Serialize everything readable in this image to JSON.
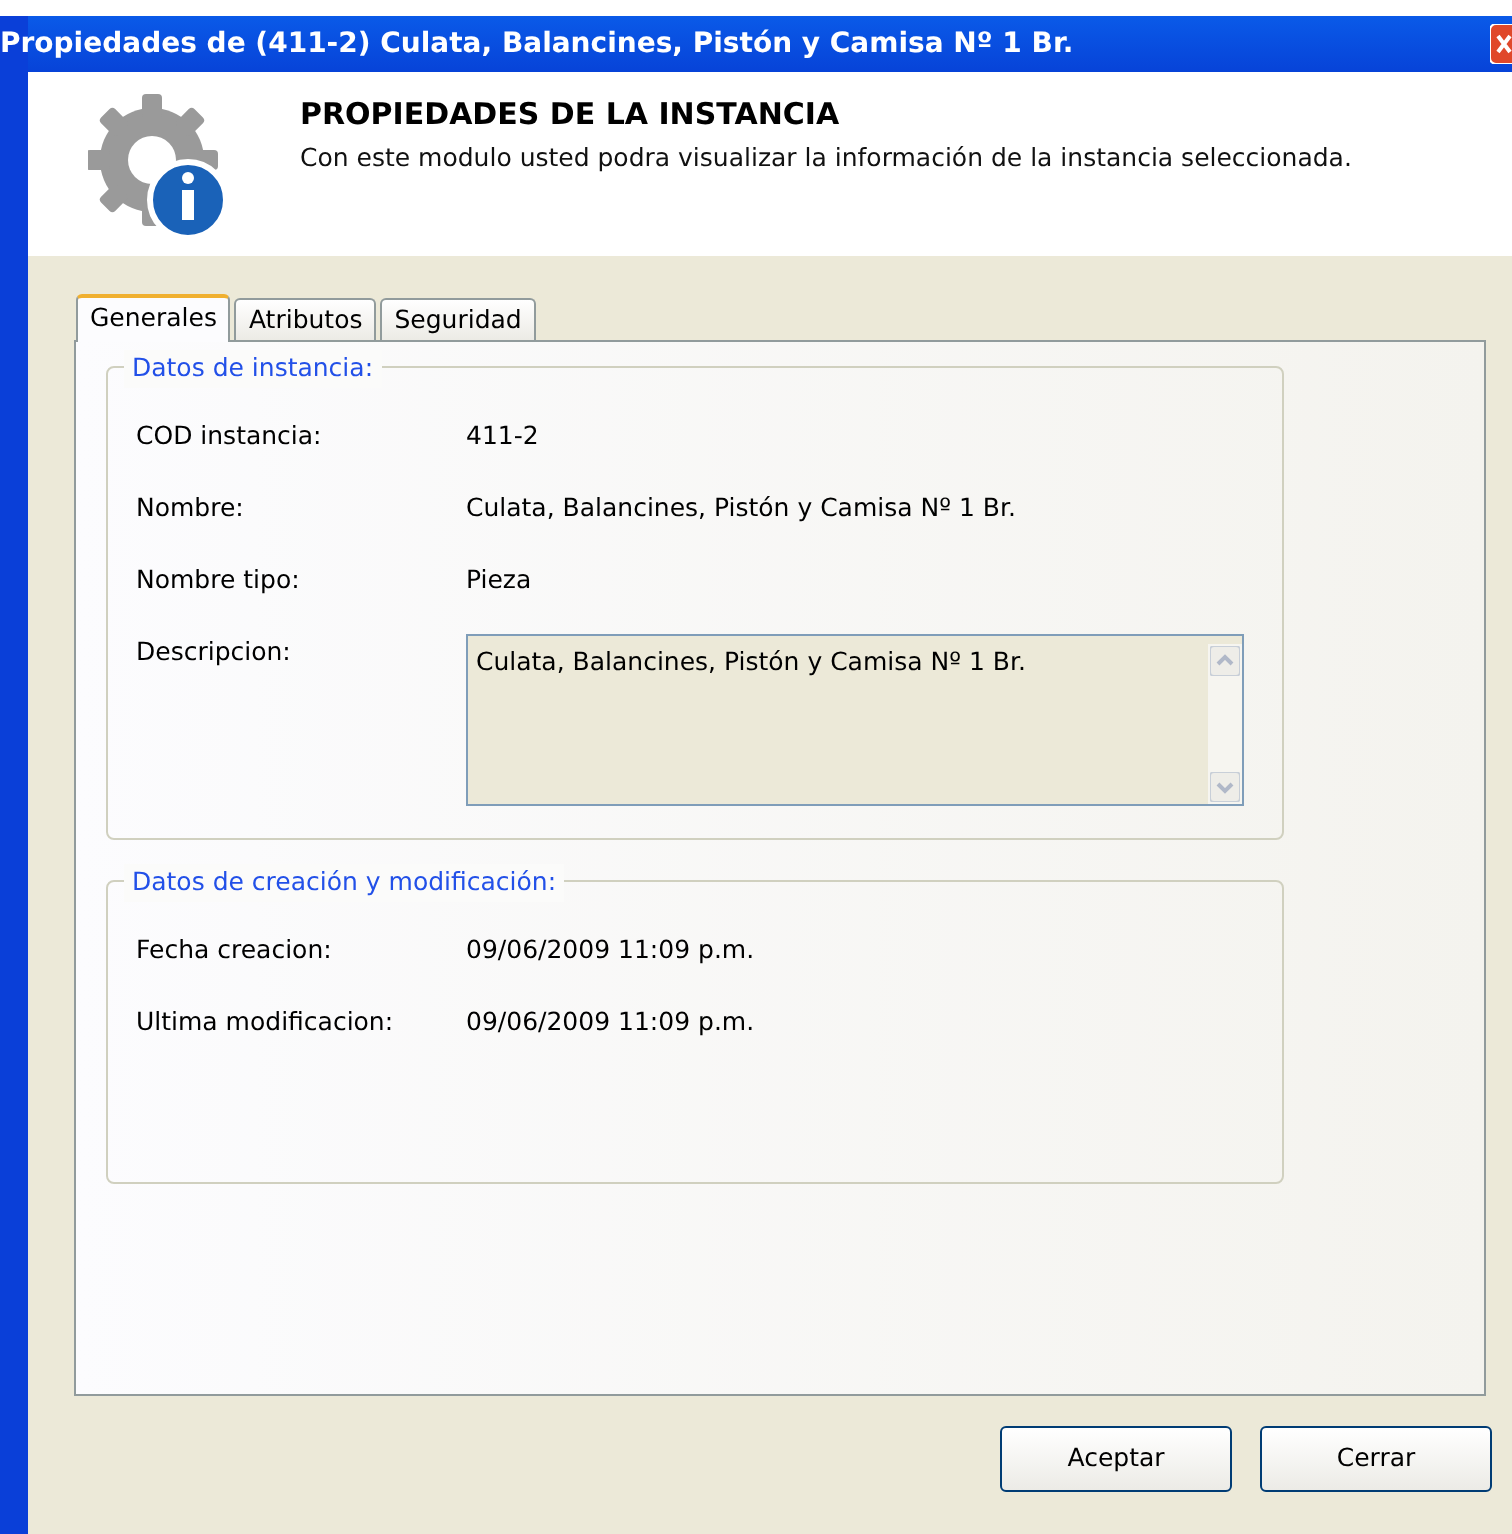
{
  "window": {
    "title": "Propiedades de (411-2) Culata, Balancines, Pistón y Camisa Nº 1 Br."
  },
  "header": {
    "title": "PROPIEDADES DE LA INSTANCIA",
    "description": "Con este modulo usted podra visualizar la información de la instancia seleccionada."
  },
  "tabs": [
    {
      "label": "Generales",
      "selected": true
    },
    {
      "label": "Atributos",
      "selected": false
    },
    {
      "label": "Seguridad",
      "selected": false
    }
  ],
  "groups": [
    {
      "title": "Datos de instancia:",
      "fields": [
        {
          "kind": "text",
          "label": "COD instancia:",
          "value": "411-2"
        },
        {
          "kind": "text",
          "label": "Nombre:",
          "value": "Culata, Balancines, Pistón y Camisa Nº 1 Br."
        },
        {
          "kind": "text",
          "label": "Nombre tipo:",
          "value": "Pieza"
        },
        {
          "kind": "memo",
          "label": "Descripcion:",
          "value": "Culata, Balancines, Pistón y Camisa Nº 1 Br."
        }
      ]
    },
    {
      "title": "Datos de creación y modificación:",
      "fields": [
        {
          "kind": "text",
          "label": "Fecha creacion:",
          "value": "09/06/2009 11:09 p.m."
        },
        {
          "kind": "text",
          "label": "Ultima modificacion:",
          "value": "09/06/2009 11:09 p.m."
        }
      ]
    }
  ],
  "buttons": [
    "Aceptar",
    "Cerrar"
  ]
}
